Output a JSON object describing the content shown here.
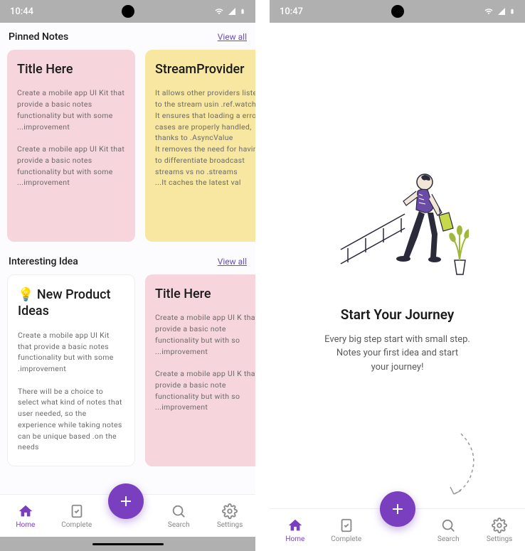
{
  "left": {
    "status_time": "10:44",
    "sections": [
      {
        "title": "Pinned Notes",
        "view_all": "View all",
        "notes": [
          {
            "color": "pink",
            "title": "Title Here",
            "body": "Create a mobile app UI Kit that provide a basic notes functionality but with some ...improvement\n\nCreate a mobile app UI Kit that provide a basic notes functionality but with some ...improvement"
          },
          {
            "color": "yellow",
            "title": "StreamProvider",
            "body": "It allows other providers listen to the stream usin .ref.watch\nIt ensures that loading a error cases are properly handled, thanks to .AsyncValue\nIt removes the need for having to differentiate broadcast streams vs no .streams\n...It caches the latest val"
          }
        ]
      },
      {
        "title": "Interesting Idea",
        "view_all": "View all",
        "notes": [
          {
            "color": "white",
            "title": "💡 New Product Ideas",
            "body": "Create a mobile app UI Kit that provide a basic notes functionality but with some .improvement\n\nThere will be a choice to select what kind of notes that user needed, so the experience while taking notes can be unique based .on the needs"
          },
          {
            "color": "pink",
            "title": "Title Here",
            "body": "Create a mobile app UI K that provide a basic note functionality but with so ...improvement\n\nCreate a mobile app UI K that provide a basic note functionality but with so ...improvement"
          }
        ]
      }
    ],
    "nav": {
      "home": "Home",
      "complete": "Complete",
      "search": "Search",
      "settings": "Settings"
    }
  },
  "right": {
    "status_time": "10:47",
    "title": "Start Your Journey",
    "subtitle": "Every big step start with small step.\nNotes your first idea and start\nyour journey!",
    "nav": {
      "home": "Home",
      "complete": "Complete",
      "search": "Search",
      "settings": "Settings"
    }
  }
}
